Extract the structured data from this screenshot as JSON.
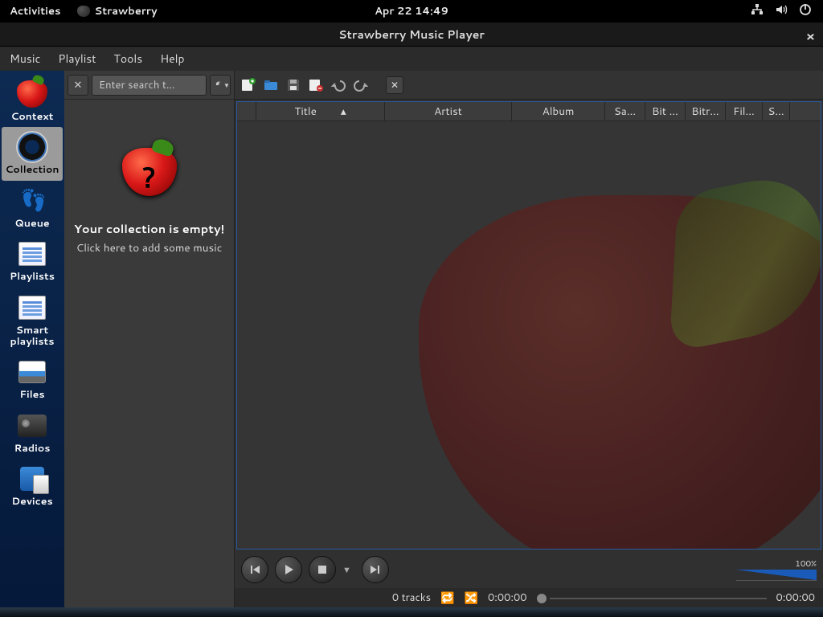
{
  "panel": {
    "activities": "Activities",
    "app_name": "Strawberry",
    "clock": "Apr 22  14:49"
  },
  "window": {
    "title": "Strawberry Music Player"
  },
  "menubar": [
    "Music",
    "Playlist",
    "Tools",
    "Help"
  ],
  "sidebar": {
    "items": [
      {
        "label": "Context"
      },
      {
        "label": "Collection"
      },
      {
        "label": "Queue"
      },
      {
        "label": "Playlists"
      },
      {
        "label": "Smart playlists"
      },
      {
        "label": "Files"
      },
      {
        "label": "Radios"
      },
      {
        "label": "Devices"
      }
    ],
    "active_index": 1
  },
  "collection": {
    "search_placeholder": "Enter search t…",
    "empty_heading": "Your collection is empty!",
    "empty_sub": "Click here to add some music"
  },
  "columns": [
    {
      "label": "",
      "w": 24
    },
    {
      "label": "Title",
      "w": 160,
      "sort": "asc"
    },
    {
      "label": "Artist",
      "w": 158
    },
    {
      "label": "Album",
      "w": 116
    },
    {
      "label": "Sa…",
      "w": 50
    },
    {
      "label": "Bit …",
      "w": 50
    },
    {
      "label": "Bitr…",
      "w": 50
    },
    {
      "label": "Fil…",
      "w": 46
    },
    {
      "label": "S…",
      "w": 34
    }
  ],
  "status": {
    "track_count": "0 tracks",
    "elapsed": "0:00:00",
    "total": "0:00:00"
  },
  "volume": {
    "label": "100%"
  }
}
